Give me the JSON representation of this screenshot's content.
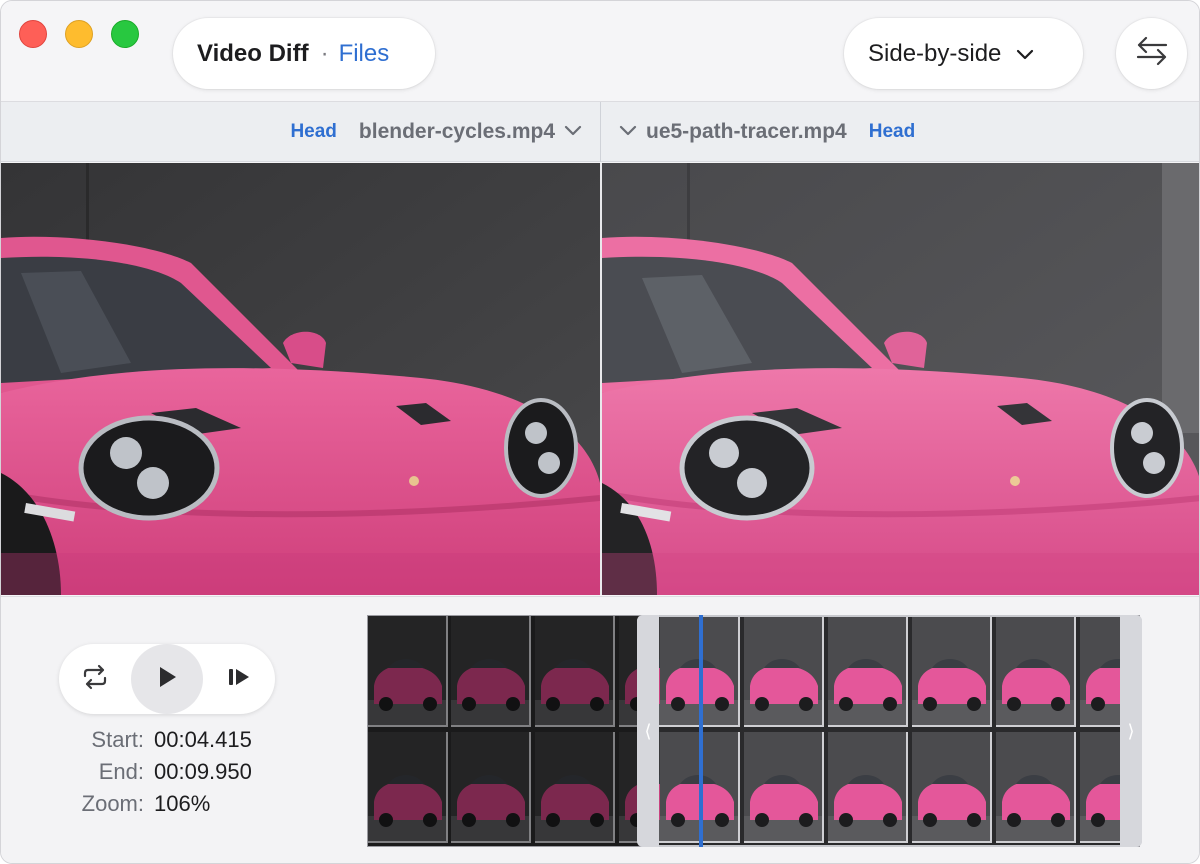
{
  "window": {
    "app_title": "Video Diff",
    "separator": "·",
    "section_link": "Files",
    "view_mode": "Side-by-side",
    "icons": [
      "close-dot",
      "minimize-dot",
      "maximize-dot",
      "chevron-down-icon",
      "swap-arrows-icon"
    ]
  },
  "file_header": {
    "left": {
      "branch": "Head",
      "file": "blender-cycles.mp4"
    },
    "right": {
      "branch": "Head",
      "file": "ue5-path-tracer.mp4"
    }
  },
  "player": {
    "icons": [
      "loop-icon",
      "play-icon",
      "step-forward-icon"
    ],
    "start_label": "Start:",
    "start_value": "00:04.415",
    "end_label": "End:",
    "end_value": "00:09.950",
    "zoom_label": "Zoom:",
    "zoom_value": "106%"
  },
  "timeline": {
    "selection_handles": [
      "left-handle",
      "right-handle"
    ],
    "handle_left_glyph": "⟨",
    "handle_right_glyph": "⟩"
  },
  "colors": {
    "accent": "#2f6fd1",
    "car_pink": "#e2518f",
    "wall_dark": "#3e3e40"
  }
}
